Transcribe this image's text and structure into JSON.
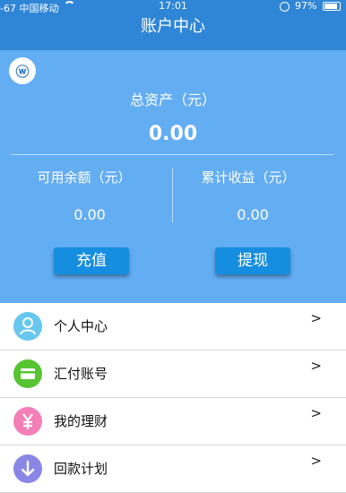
{
  "status_bar": {
    "signal": "-67",
    "carrier": "中国移动",
    "time": "17:01",
    "battery": "97%"
  },
  "header": {
    "title": "账户中心"
  },
  "logo": {
    "icon": "app-logo",
    "text": "ⓦ"
  },
  "summary": {
    "total_label": "总资产（元）",
    "total_value": "0.00",
    "available_label": "可用余额（元）",
    "available_value": "0.00",
    "earnings_label": "累计收益（元）",
    "earnings_value": "0.00"
  },
  "buttons": {
    "recharge": "充值",
    "withdraw": "提现"
  },
  "menu": [
    {
      "label": "个人中心",
      "icon": "person-icon",
      "color": "#67c7ef",
      "arrow": ">"
    },
    {
      "label": "汇付账号",
      "icon": "card-icon",
      "color": "#56c430",
      "arrow": ">"
    },
    {
      "label": "我的理财",
      "icon": "yen-icon",
      "color": "#f47eb8",
      "arrow": ">"
    },
    {
      "label": "回款计划",
      "icon": "down-arrow-icon",
      "color": "#8a86e6",
      "arrow": ">"
    }
  ],
  "colors": {
    "header": "#2f86d6",
    "panel": "#63adf3",
    "button": "#168ee0"
  }
}
